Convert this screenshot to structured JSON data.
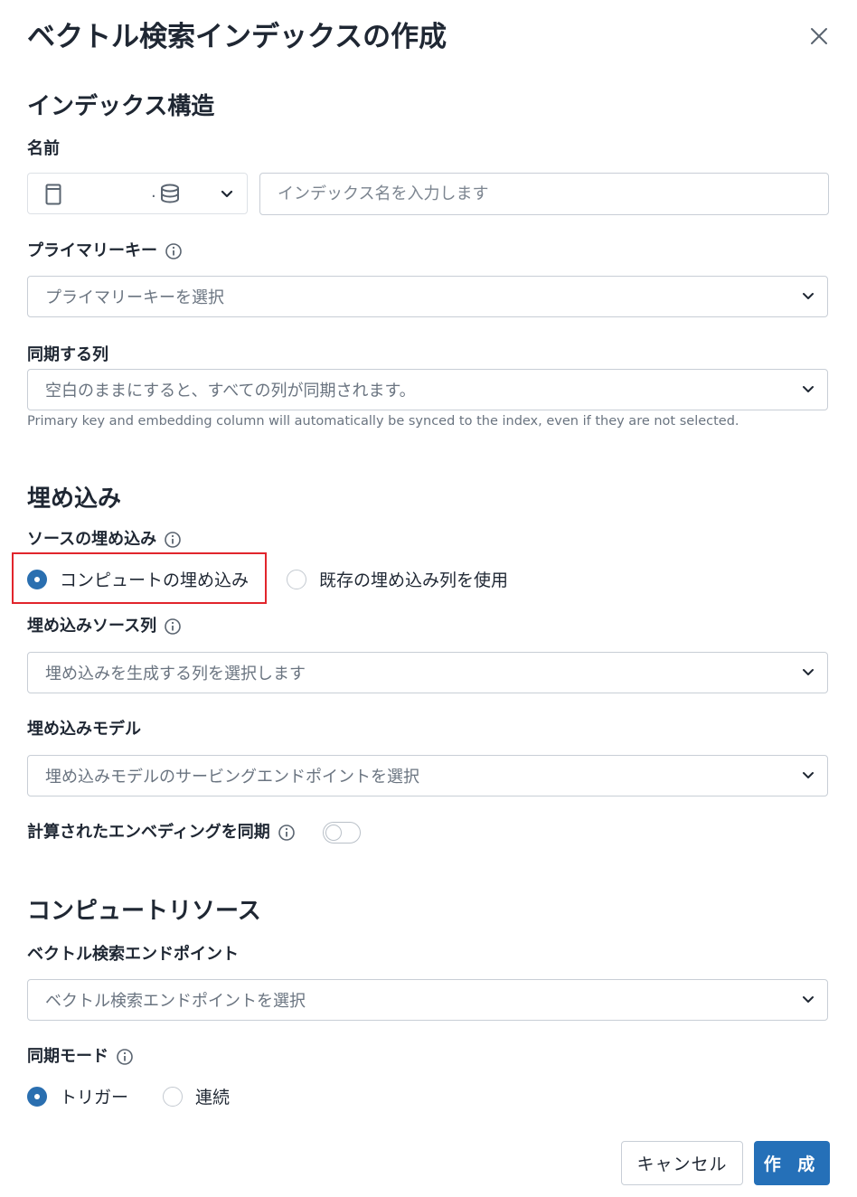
{
  "dialog": {
    "title": "ベクトル検索インデックスの作成",
    "close_icon": "close-icon"
  },
  "index_structure": {
    "heading": "インデックス構造",
    "name_label": "名前",
    "catalog_selector": {
      "schema_separator": ".",
      "icons": [
        "book-icon",
        "database-icon",
        "chevron-down-icon"
      ]
    },
    "name_placeholder": "インデックス名を入力します",
    "primary_key": {
      "label": "プライマリーキー",
      "placeholder": "プライマリーキーを選択"
    },
    "sync_columns": {
      "label": "同期する列",
      "placeholder": "空白のままにすると、すべての列が同期されます。",
      "help": "Primary key and embedding column will automatically be synced to the index, even if they are not selected."
    }
  },
  "embedding": {
    "heading": "埋め込み",
    "source_label": "ソースの埋め込み",
    "options": [
      {
        "label": "コンピュートの埋め込み",
        "selected": true
      },
      {
        "label": "既存の埋め込み列を使用",
        "selected": false
      }
    ],
    "source_column": {
      "label": "埋め込みソース列",
      "placeholder": "埋め込みを生成する列を選択します"
    },
    "model": {
      "label": "埋め込みモデル",
      "placeholder": "埋め込みモデルのサービングエンドポイントを選択"
    },
    "sync_computed": {
      "label": "計算されたエンベディングを同期",
      "enabled": false
    }
  },
  "compute": {
    "heading": "コンピュートリソース",
    "endpoint": {
      "label": "ベクトル検索エンドポイント",
      "placeholder": "ベクトル検索エンドポイントを選択"
    },
    "sync_mode": {
      "label": "同期モード",
      "options": [
        {
          "label": "トリガー",
          "selected": true
        },
        {
          "label": "連続",
          "selected": false
        }
      ]
    }
  },
  "footer": {
    "cancel": "キャンセル",
    "create": "作 成"
  },
  "colors": {
    "accent": "#2570b8",
    "highlight_border": "#e1252c",
    "text": "#1f2733",
    "muted": "#6a7480"
  }
}
